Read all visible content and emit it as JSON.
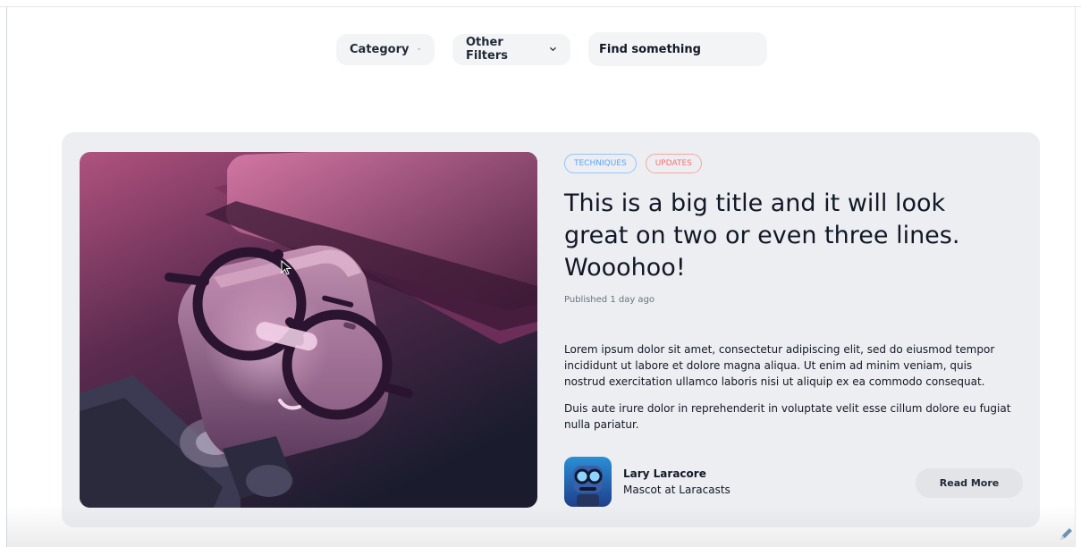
{
  "filters": {
    "category_label": "Category",
    "other_label": "Other Filters",
    "search_placeholder": "Find something"
  },
  "post": {
    "tags": [
      "TECHNIQUES",
      "UPDATES"
    ],
    "tag_colors": [
      "#60a5fa",
      "#f87171"
    ],
    "title": "This is a big title and it will look great on two or even three lines. Wooohoo!",
    "published": "Published 1 day ago",
    "paragraphs": [
      "Lorem ipsum dolor sit amet, consectetur adipiscing elit, sed do eiusmod tempor incididunt ut labore et dolore magna aliqua. Ut enim ad minim veniam, quis nostrud exercitation ullamco laboris nisi ut aliquip ex ea commodo consequat.",
      "Duis aute irure dolor in reprehenderit in voluptate velit esse cillum dolore eu fugiat nulla pariatur."
    ],
    "read_more": "Read More"
  },
  "author": {
    "name": "Lary Laracore",
    "role": "Mascot at Laracasts"
  },
  "icons": {
    "filter_chevron": "chevron-down-icon",
    "avatar": "robot-avatar",
    "corner": "pen-icon"
  },
  "colors": {
    "card_bg": "#eceef1",
    "image_gradient_top": "#b0527f",
    "image_gradient_bottom": "#1a1c2e"
  }
}
